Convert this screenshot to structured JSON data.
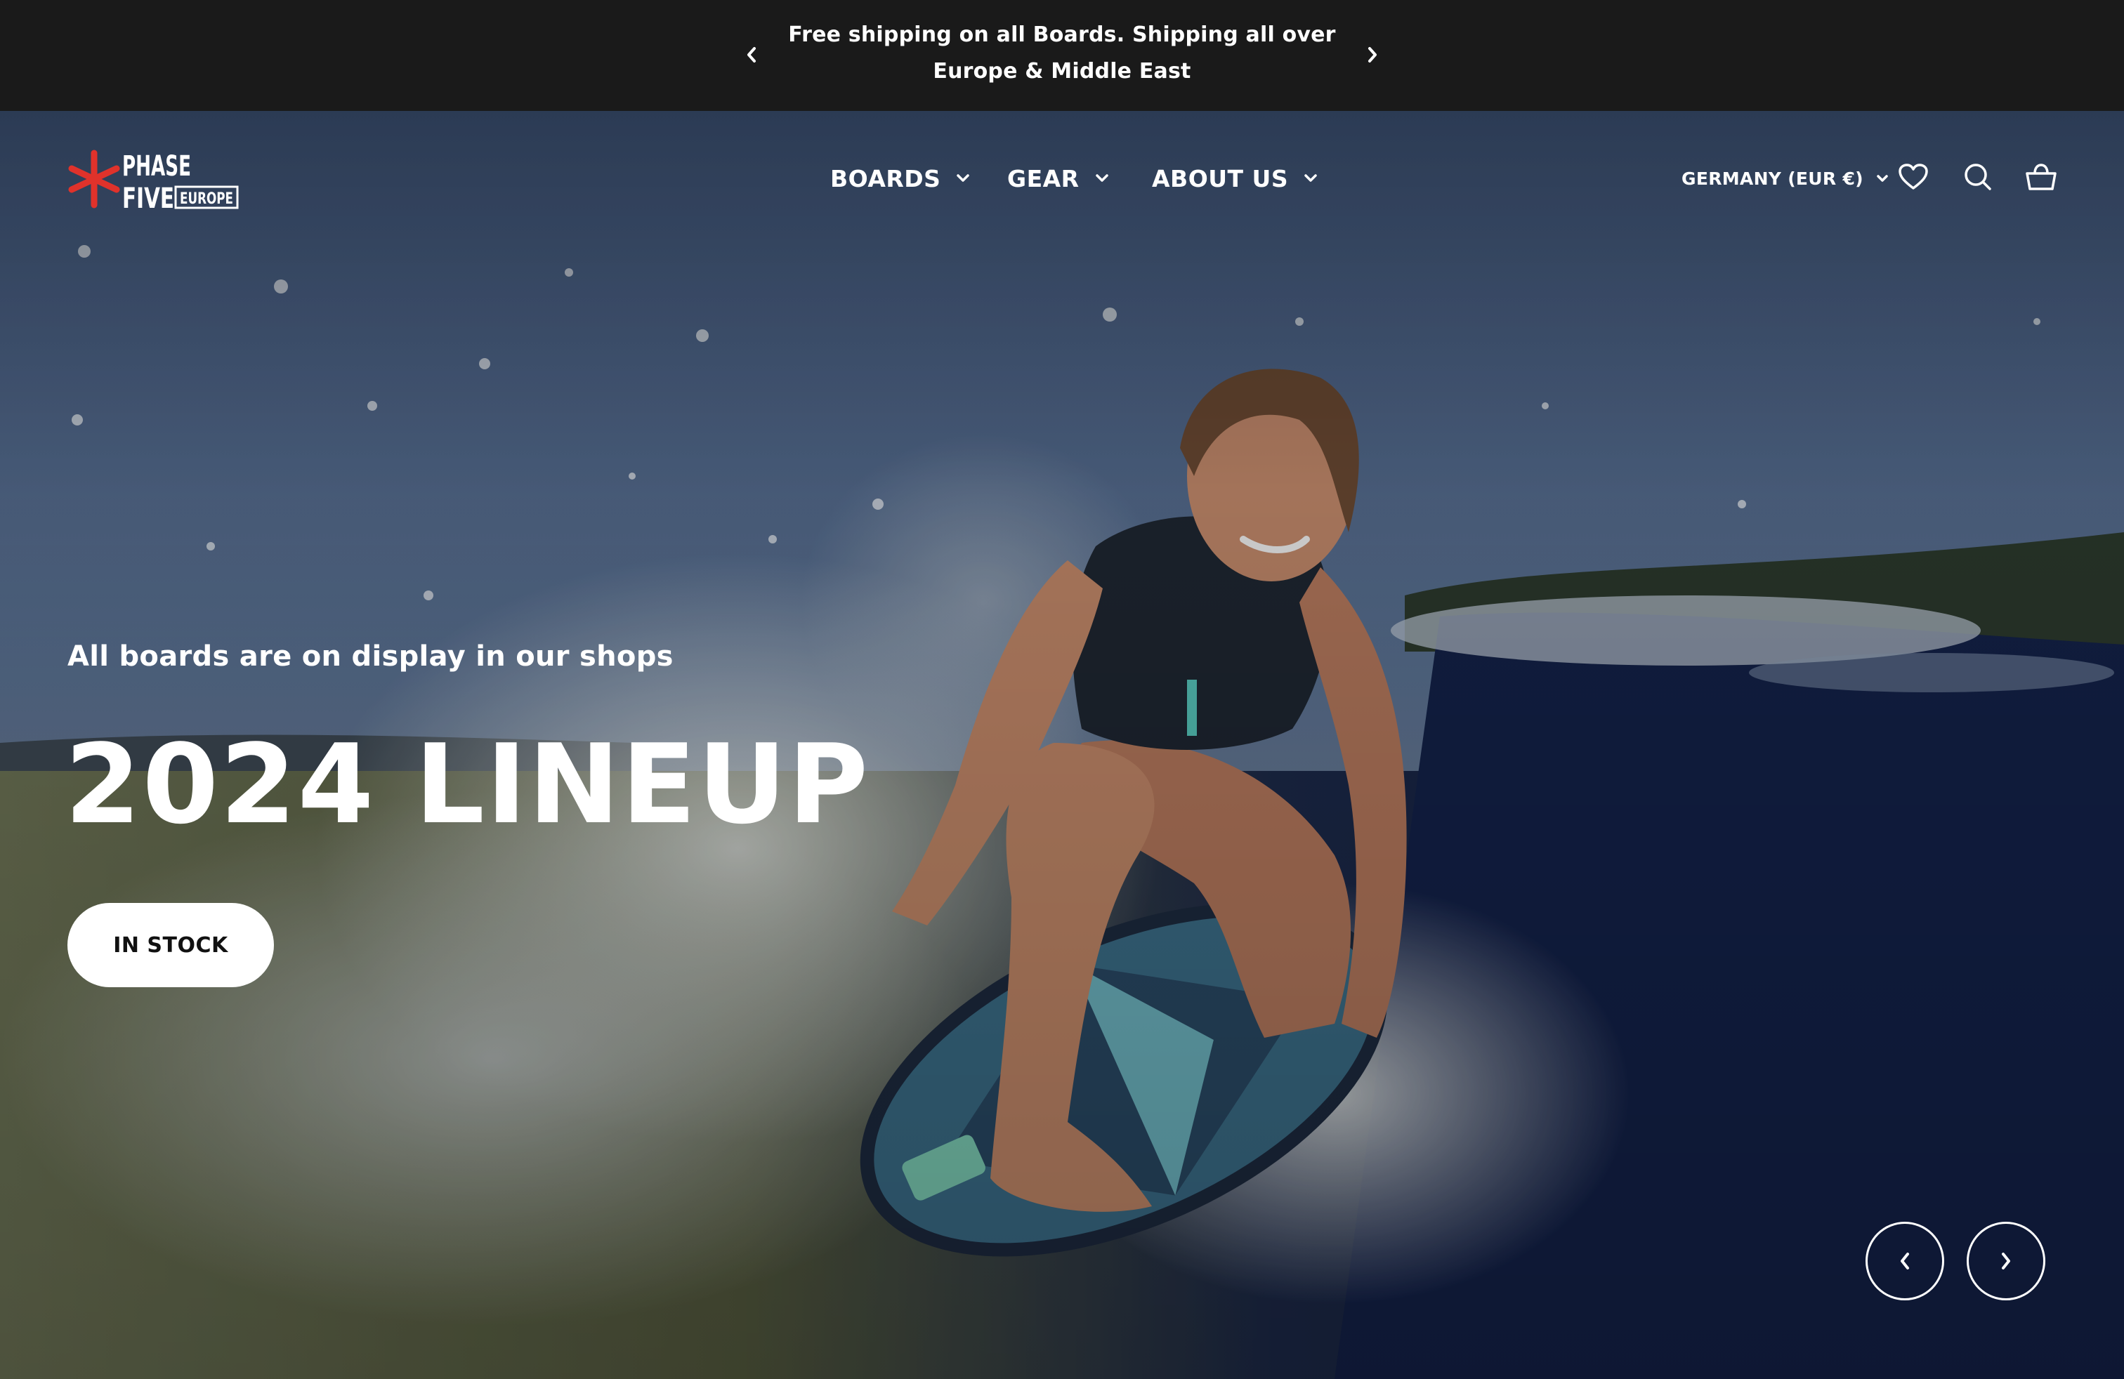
{
  "announcement": {
    "text": "Free shipping on all Boards. Shipping all over Europe & Middle East",
    "prev_icon": "chevron-left-icon",
    "next_icon": "chevron-right-icon"
  },
  "header": {
    "logo": {
      "line1": "PHASE",
      "line2": "FIVE",
      "badge": "EUROPE",
      "accent_color": "#e0322b"
    },
    "nav": [
      {
        "label": "BOARDS",
        "icon": "chevron-down-icon"
      },
      {
        "label": "GEAR",
        "icon": "chevron-down-icon"
      },
      {
        "label": "ABOUT US",
        "icon": "chevron-down-icon"
      }
    ],
    "country_selector": "GERMANY (EUR €)",
    "icons": [
      "heart-icon",
      "search-icon",
      "cart-icon"
    ]
  },
  "hero": {
    "subtitle": "All boards are on display in our shops",
    "title": "2024 LINEUP",
    "cta_label": "IN STOCK",
    "controls": [
      "chevron-left-icon",
      "chevron-right-icon"
    ]
  },
  "colors": {
    "announcement_bg": "#1a1a1a",
    "text": "#ffffff",
    "cta_bg": "#ffffff",
    "cta_text": "#111111"
  }
}
